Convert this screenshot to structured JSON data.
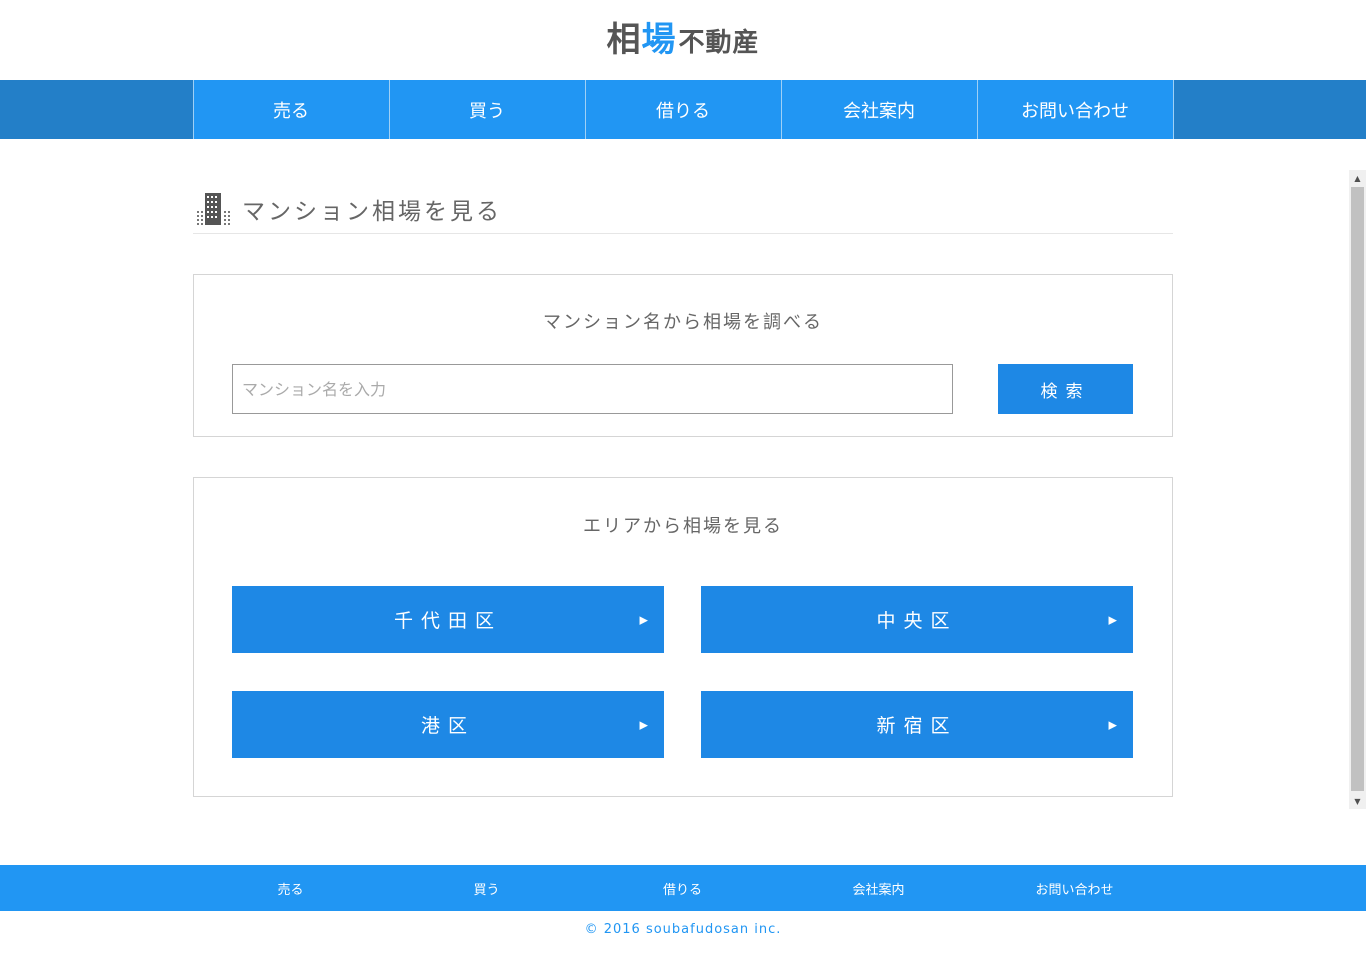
{
  "logo": {
    "part1": "相",
    "part2": "場",
    "part3": "不動産"
  },
  "nav": [
    "売る",
    "買う",
    "借りる",
    "会社案内",
    "お問い合わせ"
  ],
  "page_title": "マンション相場を見る",
  "search": {
    "heading": "マンション名から相場を調べる",
    "placeholder": "マンション名を入力",
    "button": "検索"
  },
  "area": {
    "heading": "エリアから相場を見る",
    "items": [
      "千代田区",
      "中央区",
      "港区",
      "新宿区"
    ],
    "arrow": "▶"
  },
  "footer": {
    "nav": [
      "売る",
      "買う",
      "借りる",
      "会社案内",
      "お問い合わせ"
    ],
    "copyright": "© 2016 soubafudosan inc."
  },
  "colors": {
    "primary": "#2196f3",
    "button": "#1e88e5",
    "nav_bg": "#237fc8"
  }
}
